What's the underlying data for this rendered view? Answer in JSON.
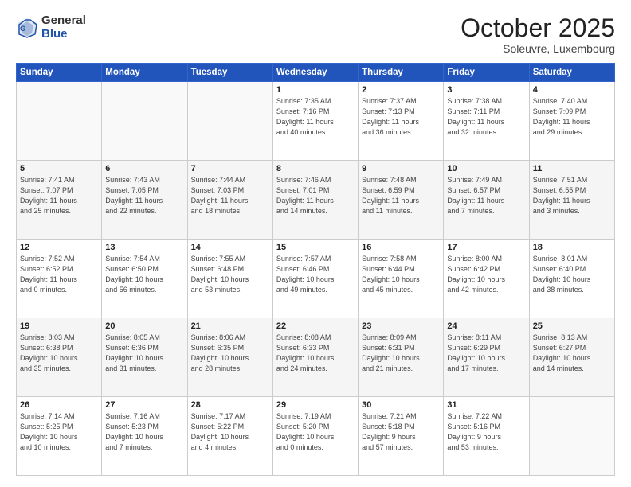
{
  "header": {
    "logo_general": "General",
    "logo_blue": "Blue",
    "month_title": "October 2025",
    "location": "Soleuvre, Luxembourg"
  },
  "weekdays": [
    "Sunday",
    "Monday",
    "Tuesday",
    "Wednesday",
    "Thursday",
    "Friday",
    "Saturday"
  ],
  "weeks": [
    [
      {
        "day": "",
        "info": ""
      },
      {
        "day": "",
        "info": ""
      },
      {
        "day": "",
        "info": ""
      },
      {
        "day": "1",
        "info": "Sunrise: 7:35 AM\nSunset: 7:16 PM\nDaylight: 11 hours\nand 40 minutes."
      },
      {
        "day": "2",
        "info": "Sunrise: 7:37 AM\nSunset: 7:13 PM\nDaylight: 11 hours\nand 36 minutes."
      },
      {
        "day": "3",
        "info": "Sunrise: 7:38 AM\nSunset: 7:11 PM\nDaylight: 11 hours\nand 32 minutes."
      },
      {
        "day": "4",
        "info": "Sunrise: 7:40 AM\nSunset: 7:09 PM\nDaylight: 11 hours\nand 29 minutes."
      }
    ],
    [
      {
        "day": "5",
        "info": "Sunrise: 7:41 AM\nSunset: 7:07 PM\nDaylight: 11 hours\nand 25 minutes."
      },
      {
        "day": "6",
        "info": "Sunrise: 7:43 AM\nSunset: 7:05 PM\nDaylight: 11 hours\nand 22 minutes."
      },
      {
        "day": "7",
        "info": "Sunrise: 7:44 AM\nSunset: 7:03 PM\nDaylight: 11 hours\nand 18 minutes."
      },
      {
        "day": "8",
        "info": "Sunrise: 7:46 AM\nSunset: 7:01 PM\nDaylight: 11 hours\nand 14 minutes."
      },
      {
        "day": "9",
        "info": "Sunrise: 7:48 AM\nSunset: 6:59 PM\nDaylight: 11 hours\nand 11 minutes."
      },
      {
        "day": "10",
        "info": "Sunrise: 7:49 AM\nSunset: 6:57 PM\nDaylight: 11 hours\nand 7 minutes."
      },
      {
        "day": "11",
        "info": "Sunrise: 7:51 AM\nSunset: 6:55 PM\nDaylight: 11 hours\nand 3 minutes."
      }
    ],
    [
      {
        "day": "12",
        "info": "Sunrise: 7:52 AM\nSunset: 6:52 PM\nDaylight: 11 hours\nand 0 minutes."
      },
      {
        "day": "13",
        "info": "Sunrise: 7:54 AM\nSunset: 6:50 PM\nDaylight: 10 hours\nand 56 minutes."
      },
      {
        "day": "14",
        "info": "Sunrise: 7:55 AM\nSunset: 6:48 PM\nDaylight: 10 hours\nand 53 minutes."
      },
      {
        "day": "15",
        "info": "Sunrise: 7:57 AM\nSunset: 6:46 PM\nDaylight: 10 hours\nand 49 minutes."
      },
      {
        "day": "16",
        "info": "Sunrise: 7:58 AM\nSunset: 6:44 PM\nDaylight: 10 hours\nand 45 minutes."
      },
      {
        "day": "17",
        "info": "Sunrise: 8:00 AM\nSunset: 6:42 PM\nDaylight: 10 hours\nand 42 minutes."
      },
      {
        "day": "18",
        "info": "Sunrise: 8:01 AM\nSunset: 6:40 PM\nDaylight: 10 hours\nand 38 minutes."
      }
    ],
    [
      {
        "day": "19",
        "info": "Sunrise: 8:03 AM\nSunset: 6:38 PM\nDaylight: 10 hours\nand 35 minutes."
      },
      {
        "day": "20",
        "info": "Sunrise: 8:05 AM\nSunset: 6:36 PM\nDaylight: 10 hours\nand 31 minutes."
      },
      {
        "day": "21",
        "info": "Sunrise: 8:06 AM\nSunset: 6:35 PM\nDaylight: 10 hours\nand 28 minutes."
      },
      {
        "day": "22",
        "info": "Sunrise: 8:08 AM\nSunset: 6:33 PM\nDaylight: 10 hours\nand 24 minutes."
      },
      {
        "day": "23",
        "info": "Sunrise: 8:09 AM\nSunset: 6:31 PM\nDaylight: 10 hours\nand 21 minutes."
      },
      {
        "day": "24",
        "info": "Sunrise: 8:11 AM\nSunset: 6:29 PM\nDaylight: 10 hours\nand 17 minutes."
      },
      {
        "day": "25",
        "info": "Sunrise: 8:13 AM\nSunset: 6:27 PM\nDaylight: 10 hours\nand 14 minutes."
      }
    ],
    [
      {
        "day": "26",
        "info": "Sunrise: 7:14 AM\nSunset: 5:25 PM\nDaylight: 10 hours\nand 10 minutes."
      },
      {
        "day": "27",
        "info": "Sunrise: 7:16 AM\nSunset: 5:23 PM\nDaylight: 10 hours\nand 7 minutes."
      },
      {
        "day": "28",
        "info": "Sunrise: 7:17 AM\nSunset: 5:22 PM\nDaylight: 10 hours\nand 4 minutes."
      },
      {
        "day": "29",
        "info": "Sunrise: 7:19 AM\nSunset: 5:20 PM\nDaylight: 10 hours\nand 0 minutes."
      },
      {
        "day": "30",
        "info": "Sunrise: 7:21 AM\nSunset: 5:18 PM\nDaylight: 9 hours\nand 57 minutes."
      },
      {
        "day": "31",
        "info": "Sunrise: 7:22 AM\nSunset: 5:16 PM\nDaylight: 9 hours\nand 53 minutes."
      },
      {
        "day": "",
        "info": ""
      }
    ]
  ]
}
